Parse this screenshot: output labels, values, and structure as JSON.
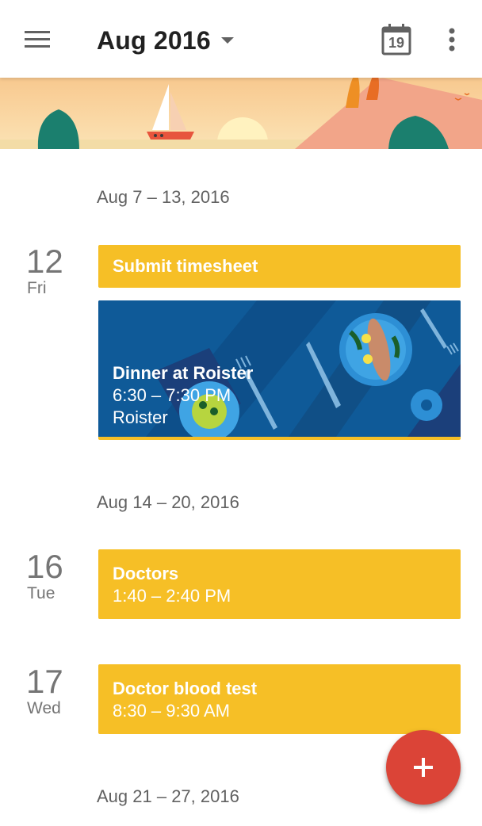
{
  "app_bar": {
    "menu_icon": "hamburger-menu-icon",
    "month_title": "Aug 2016",
    "dropdown_icon": "caret-down-icon",
    "today_icon": "calendar-today-icon",
    "today_date": "19",
    "more_icon": "more-vert-icon"
  },
  "banner": {
    "illustration": "sailboat-sunset-banner"
  },
  "weeks": [
    {
      "label": "Aug 7 – 13, 2016",
      "days": [
        {
          "num": "12",
          "name": "Fri",
          "events": [
            {
              "title": "Submit timesheet"
            },
            {
              "title": "Dinner at Roister",
              "time": "6:30 – 7:30 PM",
              "location": "Roister",
              "image": "dinner-table-illustration"
            }
          ]
        }
      ]
    },
    {
      "label": "Aug 14 – 20, 2016",
      "days": [
        {
          "num": "16",
          "name": "Tue",
          "events": [
            {
              "title": "Doctors",
              "time": "1:40 – 2:40 PM"
            }
          ]
        },
        {
          "num": "17",
          "name": "Wed",
          "events": [
            {
              "title": "Doctor blood test",
              "time": "8:30 – 9:30 AM"
            }
          ]
        }
      ]
    },
    {
      "label": "Aug 21 – 27, 2016",
      "days": []
    }
  ],
  "fab": {
    "icon": "plus-icon"
  },
  "colors": {
    "event_yellow": "#f6bf26",
    "fab_red": "#db4437",
    "dinner_blue": "#0f5a98"
  }
}
